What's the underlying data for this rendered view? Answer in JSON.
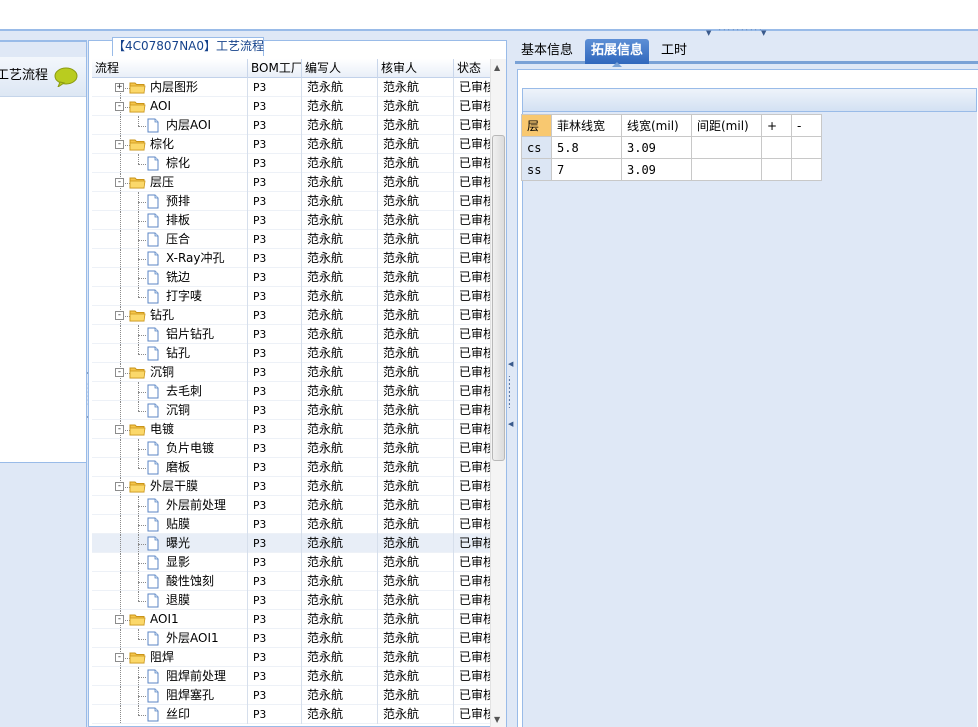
{
  "left_panel": {
    "title": "工艺流程"
  },
  "process_tab": {
    "code": "【4C07807NA0】",
    "label": "工艺流程"
  },
  "grid": {
    "columns": [
      "流程",
      "BOM工厂",
      "编写人",
      "核审人",
      "状态"
    ],
    "rows": [
      {
        "level": 0,
        "type": "folder",
        "exp": "+",
        "name": "内层图形",
        "bom": "P3",
        "writer": "范永航",
        "reviewer": "范永航",
        "status": "已审核"
      },
      {
        "level": 0,
        "type": "folder",
        "exp": "-",
        "name": "AOI",
        "bom": "P3",
        "writer": "范永航",
        "reviewer": "范永航",
        "status": "已审核"
      },
      {
        "level": 1,
        "type": "doc",
        "name": "内层AOI",
        "bom": "P3",
        "writer": "范永航",
        "reviewer": "范永航",
        "status": "已审核"
      },
      {
        "level": 0,
        "type": "folder",
        "exp": "-",
        "name": "棕化",
        "bom": "P3",
        "writer": "范永航",
        "reviewer": "范永航",
        "status": "已审核"
      },
      {
        "level": 1,
        "type": "doc",
        "name": "棕化",
        "bom": "P3",
        "writer": "范永航",
        "reviewer": "范永航",
        "status": "已审核"
      },
      {
        "level": 0,
        "type": "folder",
        "exp": "-",
        "name": "层压",
        "bom": "P3",
        "writer": "范永航",
        "reviewer": "范永航",
        "status": "已审核"
      },
      {
        "level": 1,
        "type": "doc",
        "name": "预排",
        "bom": "P3",
        "writer": "范永航",
        "reviewer": "范永航",
        "status": "已审核"
      },
      {
        "level": 1,
        "type": "doc",
        "name": "排板",
        "bom": "P3",
        "writer": "范永航",
        "reviewer": "范永航",
        "status": "已审核"
      },
      {
        "level": 1,
        "type": "doc",
        "name": "压合",
        "bom": "P3",
        "writer": "范永航",
        "reviewer": "范永航",
        "status": "已审核"
      },
      {
        "level": 1,
        "type": "doc",
        "name": "X-Ray冲孔",
        "bom": "P3",
        "writer": "范永航",
        "reviewer": "范永航",
        "status": "已审核"
      },
      {
        "level": 1,
        "type": "doc",
        "name": "铣边",
        "bom": "P3",
        "writer": "范永航",
        "reviewer": "范永航",
        "status": "已审核"
      },
      {
        "level": 1,
        "type": "doc",
        "name": "打字唛",
        "bom": "P3",
        "writer": "范永航",
        "reviewer": "范永航",
        "status": "已审核"
      },
      {
        "level": 0,
        "type": "folder",
        "exp": "-",
        "name": "钻孔",
        "bom": "P3",
        "writer": "范永航",
        "reviewer": "范永航",
        "status": "已审核"
      },
      {
        "level": 1,
        "type": "doc",
        "name": "铝片钻孔",
        "bom": "P3",
        "writer": "范永航",
        "reviewer": "范永航",
        "status": "已审核"
      },
      {
        "level": 1,
        "type": "doc",
        "name": "钻孔",
        "bom": "P3",
        "writer": "范永航",
        "reviewer": "范永航",
        "status": "已审核"
      },
      {
        "level": 0,
        "type": "folder",
        "exp": "-",
        "name": "沉铜",
        "bom": "P3",
        "writer": "范永航",
        "reviewer": "范永航",
        "status": "已审核"
      },
      {
        "level": 1,
        "type": "doc",
        "name": "去毛刺",
        "bom": "P3",
        "writer": "范永航",
        "reviewer": "范永航",
        "status": "已审核"
      },
      {
        "level": 1,
        "type": "doc",
        "name": "沉铜",
        "bom": "P3",
        "writer": "范永航",
        "reviewer": "范永航",
        "status": "已审核"
      },
      {
        "level": 0,
        "type": "folder",
        "exp": "-",
        "name": "电镀",
        "bom": "P3",
        "writer": "范永航",
        "reviewer": "范永航",
        "status": "已审核"
      },
      {
        "level": 1,
        "type": "doc",
        "name": "负片电镀",
        "bom": "P3",
        "writer": "范永航",
        "reviewer": "范永航",
        "status": "已审核"
      },
      {
        "level": 1,
        "type": "doc",
        "name": "磨板",
        "bom": "P3",
        "writer": "范永航",
        "reviewer": "范永航",
        "status": "已审核"
      },
      {
        "level": 0,
        "type": "folder",
        "exp": "-",
        "name": "外层干膜",
        "bom": "P3",
        "writer": "范永航",
        "reviewer": "范永航",
        "status": "已审核"
      },
      {
        "level": 1,
        "type": "doc",
        "name": "外层前处理",
        "bom": "P3",
        "writer": "范永航",
        "reviewer": "范永航",
        "status": "已审核"
      },
      {
        "level": 1,
        "type": "doc",
        "name": "贴膜",
        "bom": "P3",
        "writer": "范永航",
        "reviewer": "范永航",
        "status": "已审核"
      },
      {
        "level": 1,
        "type": "doc",
        "name": "曝光",
        "bom": "P3",
        "writer": "范永航",
        "reviewer": "范永航",
        "status": "已审核",
        "selected": true
      },
      {
        "level": 1,
        "type": "doc",
        "name": "显影",
        "bom": "P3",
        "writer": "范永航",
        "reviewer": "范永航",
        "status": "已审核"
      },
      {
        "level": 1,
        "type": "doc",
        "name": "酸性蚀刻",
        "bom": "P3",
        "writer": "范永航",
        "reviewer": "范永航",
        "status": "已审核"
      },
      {
        "level": 1,
        "type": "doc",
        "name": "退膜",
        "bom": "P3",
        "writer": "范永航",
        "reviewer": "范永航",
        "status": "已审核"
      },
      {
        "level": 0,
        "type": "folder",
        "exp": "-",
        "name": "AOI1",
        "bom": "P3",
        "writer": "范永航",
        "reviewer": "范永航",
        "status": "已审核"
      },
      {
        "level": 1,
        "type": "doc",
        "name": "外层AOI1",
        "bom": "P3",
        "writer": "范永航",
        "reviewer": "范永航",
        "status": "已审核"
      },
      {
        "level": 0,
        "type": "folder",
        "exp": "-",
        "name": "阻焊",
        "bom": "P3",
        "writer": "范永航",
        "reviewer": "范永航",
        "status": "已审核"
      },
      {
        "level": 1,
        "type": "doc",
        "name": "阻焊前处理",
        "bom": "P3",
        "writer": "范永航",
        "reviewer": "范永航",
        "status": "已审核"
      },
      {
        "level": 1,
        "type": "doc",
        "name": "阻焊塞孔",
        "bom": "P3",
        "writer": "范永航",
        "reviewer": "范永航",
        "status": "已审核"
      },
      {
        "level": 1,
        "type": "doc",
        "name": "丝印",
        "bom": "P3",
        "writer": "范永航",
        "reviewer": "范永航",
        "status": "已审核"
      }
    ]
  },
  "right_tabs": [
    {
      "label": "基本信息",
      "active": false
    },
    {
      "label": "拓展信息",
      "active": true
    },
    {
      "label": "工时",
      "active": false
    }
  ],
  "spec_table": {
    "headers": [
      "层",
      "菲林线宽",
      "线宽(mil)",
      "间距(mil)",
      "+",
      "-"
    ],
    "rows": [
      [
        "cs",
        "5.8",
        "3.09",
        "",
        "",
        ""
      ],
      [
        "ss",
        "7",
        "3.09",
        "",
        "",
        ""
      ]
    ]
  },
  "colors": {
    "panel_bg": "#dfe8f6",
    "border": "#99bbe8",
    "active_tab": "#2f67bd",
    "header_highlight": "#f8c870"
  }
}
